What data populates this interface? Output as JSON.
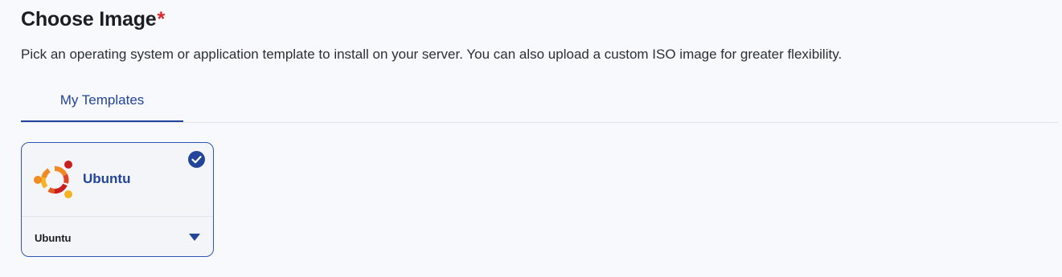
{
  "header": {
    "title": "Choose Image",
    "required_marker": "*",
    "description": "Pick an operating system or application template to install on your server. You can also upload a custom ISO image for greater flexibility."
  },
  "tabs": [
    {
      "label": "My Templates",
      "active": true
    }
  ],
  "templates": [
    {
      "name": "Ubuntu",
      "icon": "ubuntu-logo-icon",
      "selected": true,
      "selected_version": "Ubuntu"
    }
  ],
  "colors": {
    "accent": "#23449b",
    "required": "#e0242b",
    "card_border": "#2f56b6"
  }
}
